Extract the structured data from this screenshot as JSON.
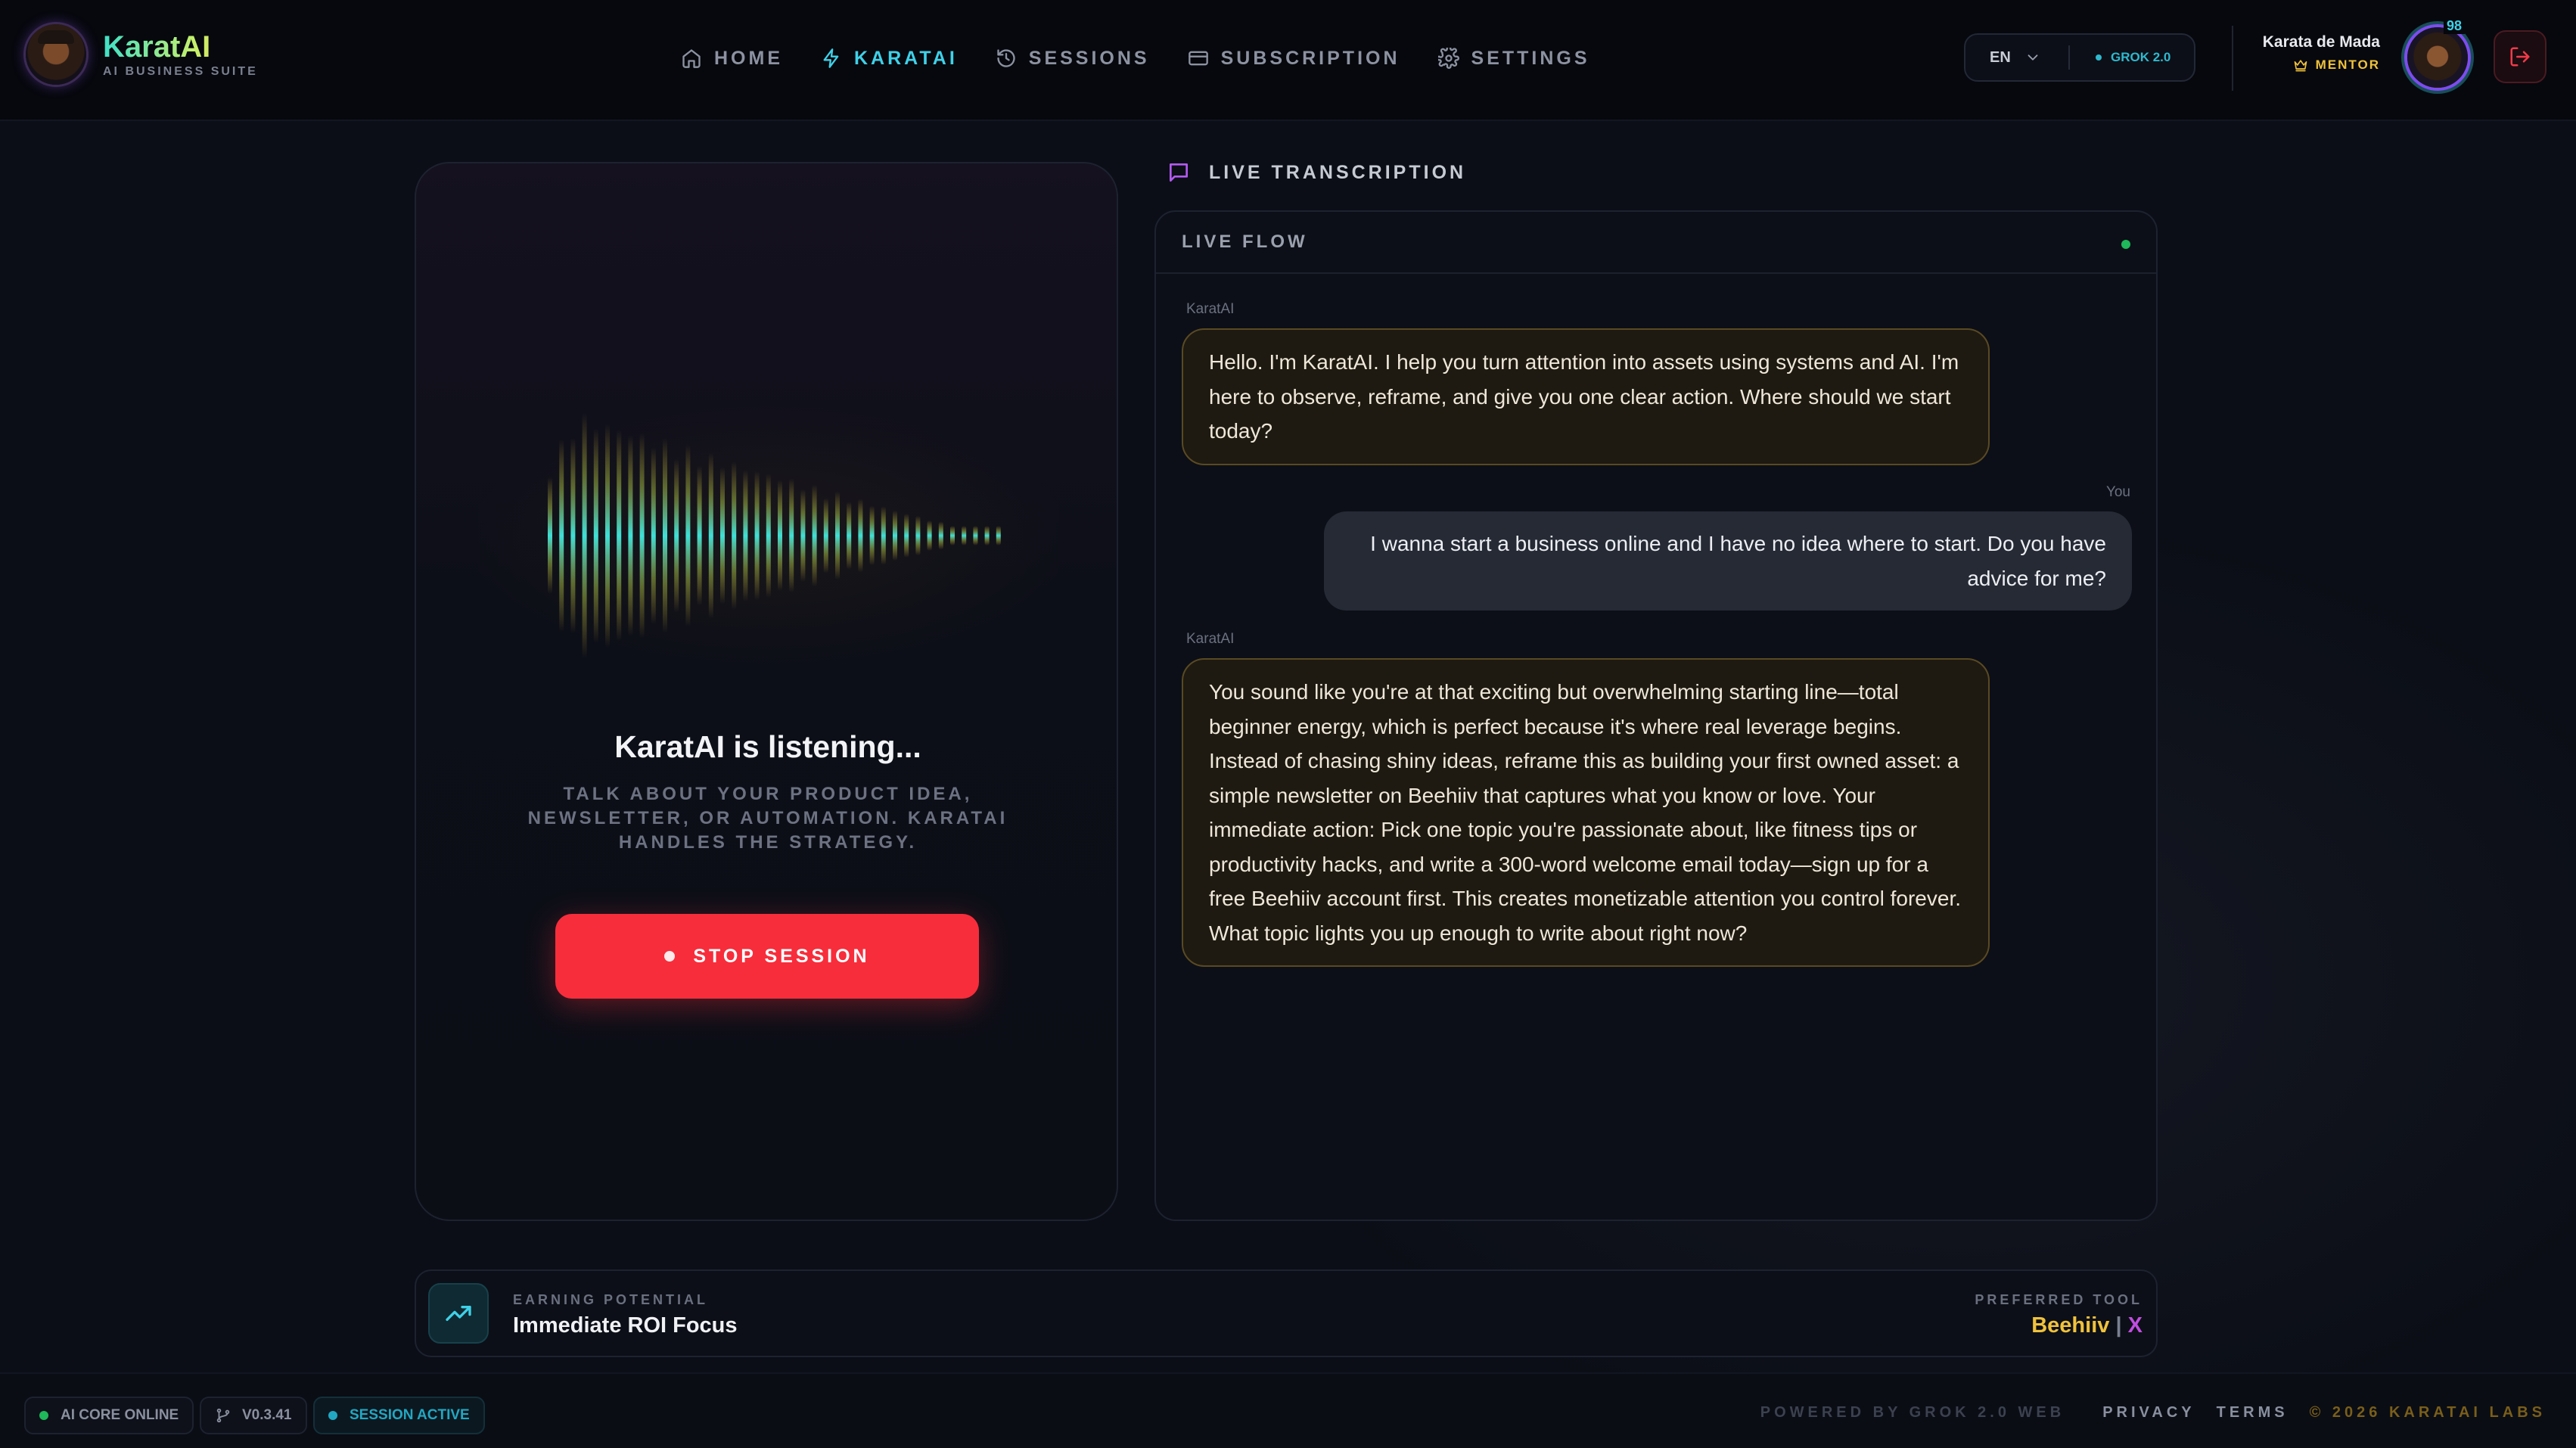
{
  "brand": {
    "name": "KaratAI",
    "subtitle": "AI BUSINESS SUITE"
  },
  "nav": [
    {
      "label": "HOME",
      "icon": "home-icon",
      "active": false
    },
    {
      "label": "KARATAI",
      "icon": "bolt-icon",
      "active": true
    },
    {
      "label": "SESSIONS",
      "icon": "history-icon",
      "active": false
    },
    {
      "label": "SUBSCRIPTION",
      "icon": "card-icon",
      "active": false
    },
    {
      "label": "SETTINGS",
      "icon": "gear-icon",
      "active": false
    }
  ],
  "header": {
    "language": "EN",
    "model": "GROK 2.0",
    "user": {
      "name": "Karata de Mada",
      "role": "MENTOR",
      "level": "98"
    }
  },
  "voice": {
    "status": "KaratAI is listening...",
    "prompt": "TALK ABOUT YOUR PRODUCT IDEA, NEWSLETTER, OR AUTOMATION. KARATAI HANDLES THE STRATEGY.",
    "stop_label": "STOP SESSION"
  },
  "transcript": {
    "title": "LIVE TRANSCRIPTION",
    "flow_label": "LIVE FLOW",
    "messages": [
      {
        "sender": "KaratAI",
        "text": "Hello. I'm KaratAI. I help you turn attention into assets using systems and AI. I'm here to observe, reframe, and give you one clear action. Where should we start today?"
      },
      {
        "sender": "You",
        "text": "I wanna start a business online and I have no idea where to start. Do you have advice for me?"
      },
      {
        "sender": "KaratAI",
        "text": "You sound like you're at that exciting but overwhelming starting line—total beginner energy, which is perfect because it's where real leverage begins. Instead of chasing shiny ideas, reframe this as building your first owned asset: a simple newsletter on Beehiiv that captures what you know or love. Your immediate action: Pick one topic you're passionate about, like fitness tips or productivity hacks, and write a 300-word welcome email today—sign up for a free Beehiiv account first. This creates monetizable attention you control forever. What topic lights you up enough to write about right now?"
      }
    ]
  },
  "stats": {
    "earning_label": "EARNING POTENTIAL",
    "earning_value": "Immediate ROI Focus",
    "tool_label": "PREFERRED TOOL",
    "tool_primary": "Beehiiv",
    "tool_separator": "|",
    "tool_secondary": "X"
  },
  "footer": {
    "core_status": "AI CORE ONLINE",
    "version": "V0.3.41",
    "session_status": "SESSION ACTIVE",
    "powered_by": "POWERED BY GROK 2.0 WEB",
    "privacy": "PRIVACY",
    "terms": "TERMS",
    "copyright": "© 2026 KARATAI LABS"
  },
  "colors": {
    "accent": "#3fd1e8",
    "danger": "#f72d3b",
    "gold": "#f0c23c",
    "online": "#1fb85a"
  }
}
